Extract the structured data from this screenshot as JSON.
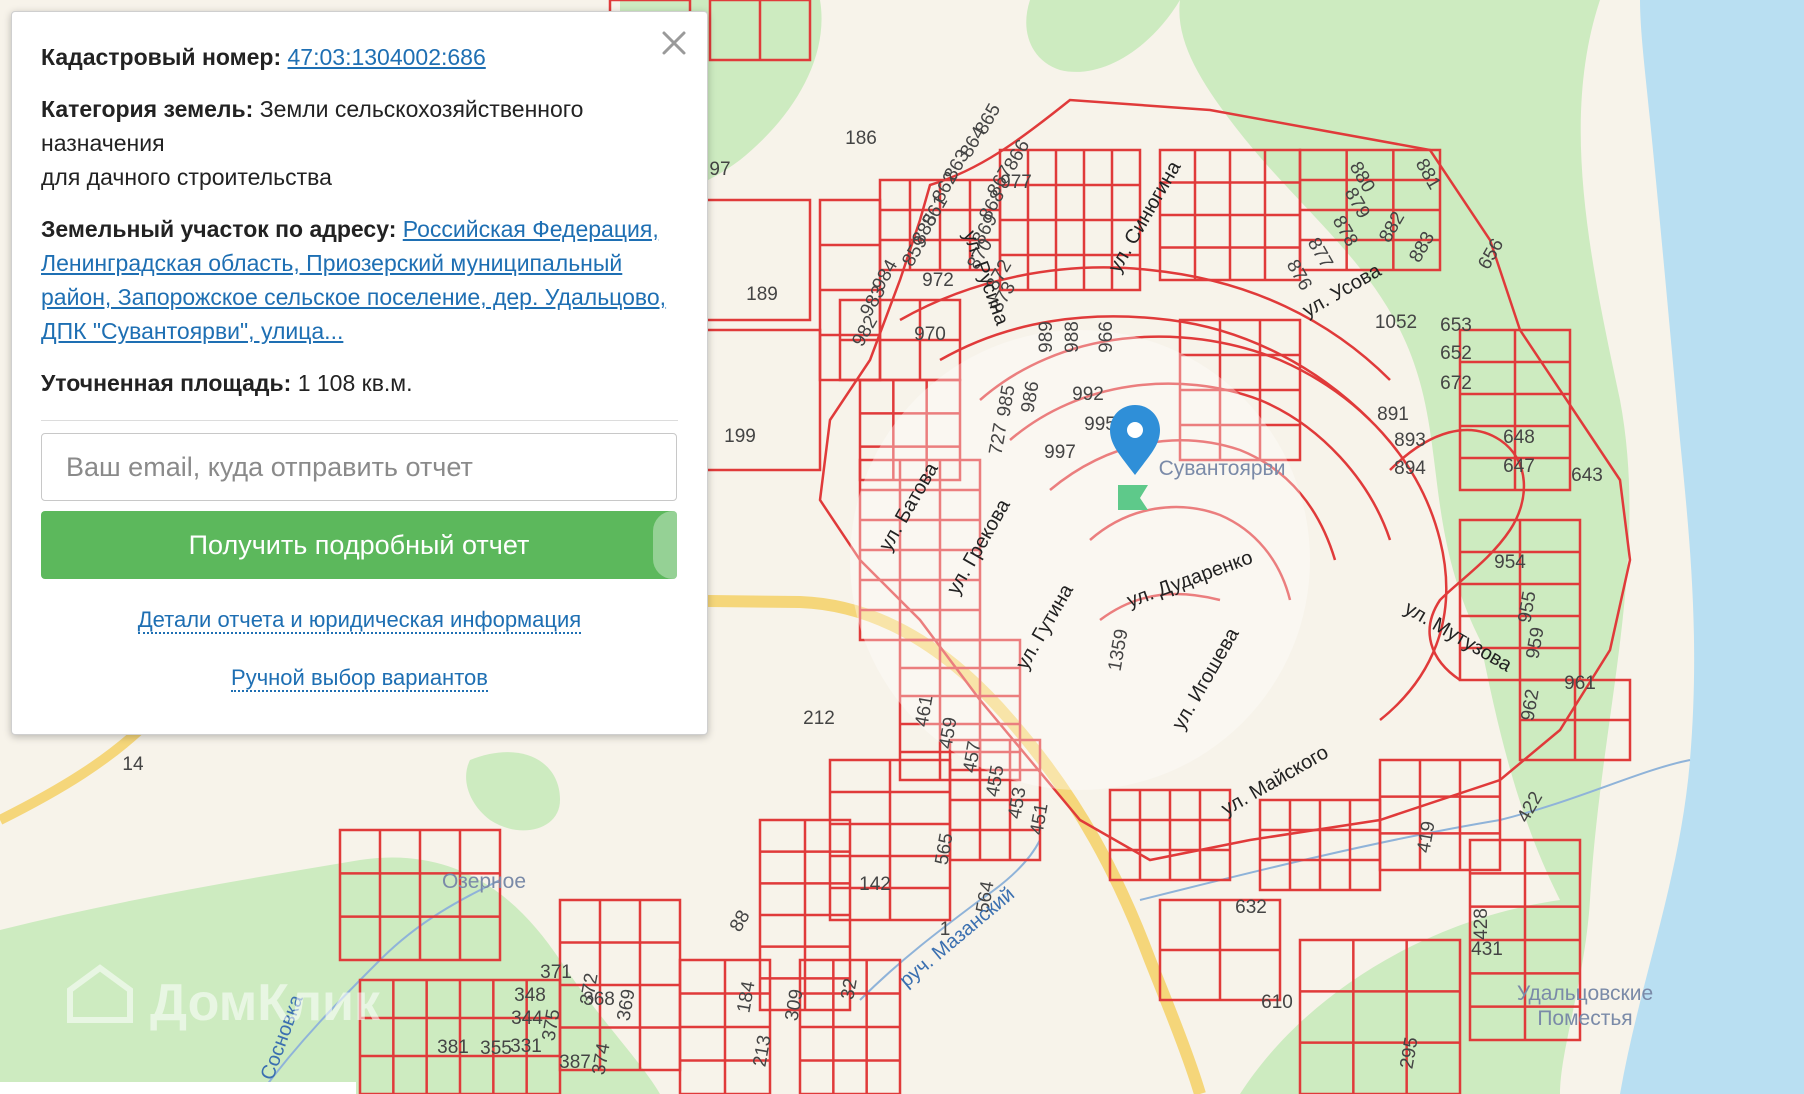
{
  "map": {
    "parcel_numbers": [
      "865",
      "864",
      "866",
      "863",
      "867",
      "862",
      "868",
      "861",
      "869",
      "870",
      "885",
      "872",
      "873",
      "859",
      "984",
      "983",
      "982",
      "977",
      "972",
      "970",
      "986",
      "985",
      "989",
      "966",
      "988",
      "992",
      "995",
      "997",
      "727",
      "1052",
      "653",
      "652",
      "672",
      "891",
      "893",
      "894",
      "880",
      "879",
      "878",
      "877",
      "876",
      "881",
      "882",
      "883",
      "656",
      "648",
      "647",
      "643",
      "954",
      "955",
      "959",
      "961",
      "962",
      "1359",
      "212",
      "461",
      "459",
      "457",
      "455",
      "453",
      "451",
      "565",
      "564",
      "142",
      "88",
      "632",
      "610",
      "419",
      "422",
      "428",
      "431",
      "371",
      "372",
      "369",
      "368",
      "348",
      "375",
      "344",
      "331",
      "355",
      "381",
      "387",
      "374",
      "184",
      "309",
      "213",
      "32",
      "1",
      "186",
      "189",
      "199",
      "97",
      "14",
      "77",
      "295"
    ],
    "street_names": [
      "ул. Русина",
      "ул. Синюгина",
      "ул. Усова",
      "ул. Батова",
      "ул. Грекова",
      "ул. Гутина",
      "ул. Дударенко",
      "ул. Мутузова",
      "ул. Игошева",
      "ул. Майского",
      "руч. Мазанский",
      "р. Сосновка"
    ],
    "place_names": [
      "Сувантоярви",
      "Озерное",
      "Удальцовские Поместья"
    ],
    "watermark": "ДомКлик",
    "colors": {
      "parcel_line": "#e03a3a",
      "water": "#b9dff2",
      "forest": "#cdebc0",
      "land": "#f7f3ea",
      "road": "#f5d67a",
      "marker": "#2f8fd8",
      "marker_flag": "#5ec98a"
    }
  },
  "popup": {
    "cadastral_label": "Кадастровый номер:",
    "cadastral_value": "47:03:1304002:686",
    "category_label": "Категория земель:",
    "category_value": "Земли сельскохозяйственного назначения",
    "category_use": "для дачного строительства",
    "address_label": "Земельный участок по адресу:",
    "address_value": "Российская Федерация, Ленинградская область, Приозерский муниципальный район, Запорожское сельское поселение, дер. Удальцово, ДПК \"Сувантоярви\", улица...",
    "area_label": "Уточненная площадь:",
    "area_value": "1 108 кв.м.",
    "email_placeholder": "Ваш email, куда отправить отчет",
    "cta_label": "Получить подробный отчет",
    "details_link": "Детали отчета и юридическая информация",
    "manual_link": "Ручной выбор вариантов",
    "close_icon": "close-icon"
  }
}
